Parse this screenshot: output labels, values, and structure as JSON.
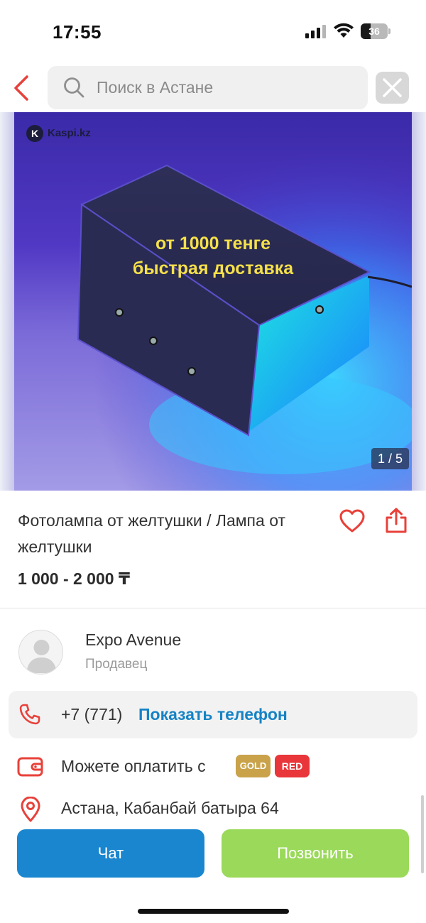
{
  "status_bar": {
    "time": "17:55",
    "battery": "36",
    "battery_level": 0.36
  },
  "search": {
    "placeholder": "Поиск в Астане"
  },
  "gallery": {
    "watermark": "Kaspi.kz",
    "promo_line1": "от 1000 тенге",
    "promo_line2": "быстрая доставка",
    "counter": "1 / 5"
  },
  "product": {
    "title": "Фотолампа от желтушки / Лампа от желтушки",
    "price": "1 000 - 2 000 ₸"
  },
  "seller": {
    "name": "Expo Avenue",
    "role": "Продавец"
  },
  "contact": {
    "phone_partial": "+7 (771)",
    "show_phone_label": "Показать телефон"
  },
  "payment": {
    "text": "Можете оплатить с",
    "badge_gold": "GOLD",
    "badge_red": "RED"
  },
  "address": {
    "text": "Астана, Кабанбай батыра 64"
  },
  "actions": {
    "chat_label": "Чат",
    "call_label": "Позвонить"
  },
  "colors": {
    "accent_red": "#e8413a",
    "link_blue": "#1683c5",
    "chat_button": "#1a86cf",
    "call_button": "#9ad95a",
    "gold_badge": "#c9a24a",
    "red_badge": "#e8363a"
  }
}
